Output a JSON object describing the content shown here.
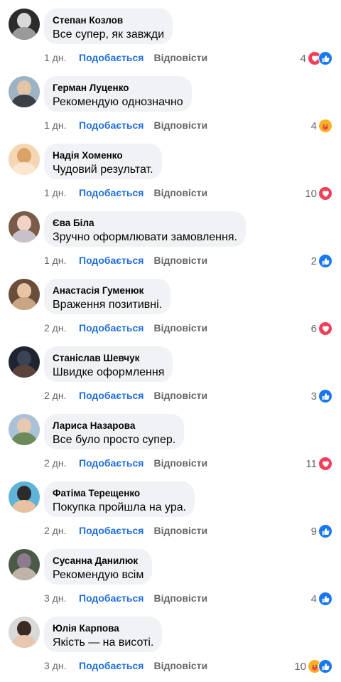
{
  "labels": {
    "like": "Подобається",
    "reply": "Відповісти"
  },
  "colors": {
    "like": "#1877f2",
    "love": "#f33e58",
    "care": "#f7b125",
    "link": "#216fdb",
    "bubble": "#f0f2f5"
  },
  "comments": [
    {
      "author": "Степан Козлов",
      "text": "Все супер, як завжди",
      "time": "1 дн.",
      "count": "4",
      "reactions": [
        "love-icon",
        "like-icon"
      ],
      "avatar_colors": [
        "#2c2c2c",
        "#d8d8d8",
        "#9a9a9a"
      ]
    },
    {
      "author": "Герман Луценко",
      "text": "Рекомендую однозначно",
      "time": "1 дн.",
      "count": "4",
      "reactions": [
        "care-icon"
      ],
      "avatar_colors": [
        "#9db3c4",
        "#e0c5a6",
        "#3b3f46"
      ]
    },
    {
      "author": "Надія Хоменко",
      "text": "Чудовий результат.",
      "time": "1 дн.",
      "count": "10",
      "reactions": [
        "love-icon"
      ],
      "avatar_colors": [
        "#f5d6b2",
        "#d9a36a",
        "#fbe7d0"
      ]
    },
    {
      "author": "Єва Біла",
      "text": "Зручно оформлювати замовлення.",
      "time": "1 дн.",
      "count": "2",
      "reactions": [
        "like-icon"
      ],
      "avatar_colors": [
        "#7a5b4a",
        "#f1d2c4",
        "#c8c2c8"
      ]
    },
    {
      "author": "Анастасія Гуменюк",
      "text": "Враження позитивні.",
      "time": "2 дн.",
      "count": "6",
      "reactions": [
        "love-icon"
      ],
      "avatar_colors": [
        "#6b4d3c",
        "#e8c3a4",
        "#c9a583"
      ]
    },
    {
      "author": "Станіслав Шевчук",
      "text": "Швидке оформлення",
      "time": "2 дн.",
      "count": "3",
      "reactions": [
        "like-icon"
      ],
      "avatar_colors": [
        "#1e2430",
        "#3a4454",
        "#5a4338"
      ]
    },
    {
      "author": "Лариса Назарова",
      "text": "Все було просто супер.",
      "time": "2 дн.",
      "count": "11",
      "reactions": [
        "love-icon"
      ],
      "avatar_colors": [
        "#a9c2d8",
        "#e6c9b0",
        "#6d8a5a"
      ]
    },
    {
      "author": "Фатіма Терещенко",
      "text": "Покупка пройшла на ура.",
      "time": "2 дн.",
      "count": "9",
      "reactions": [
        "like-icon"
      ],
      "avatar_colors": [
        "#5fb3d9",
        "#2b2b2b",
        "#e8c1a3"
      ]
    },
    {
      "author": "Сусанна Данилюк",
      "text": "Рекомендую всім",
      "time": "3 дн.",
      "count": "4",
      "reactions": [
        "like-icon"
      ],
      "avatar_colors": [
        "#4b5a46",
        "#8c7a8e",
        "#bfb3a8"
      ]
    },
    {
      "author": "Юлія Карпова",
      "text": "Якість — на висоті.",
      "time": "3 дн.",
      "count": "10",
      "reactions": [
        "care-icon",
        "like-icon"
      ],
      "avatar_colors": [
        "#d9d9d9",
        "#3a2a24",
        "#e8c6b0"
      ]
    }
  ]
}
